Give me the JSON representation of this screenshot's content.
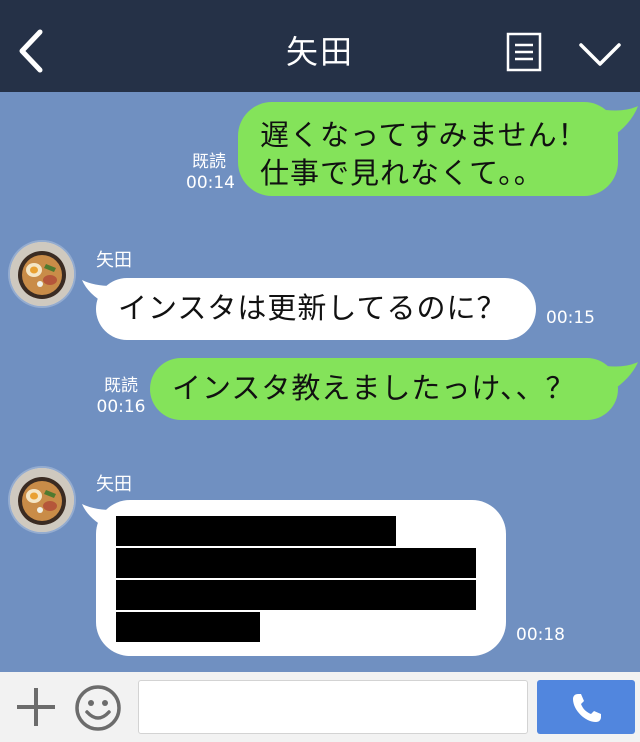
{
  "header": {
    "title": "矢田",
    "back_icon": "chevron-left-icon",
    "menu_icon": "menu-icon",
    "collapse_icon": "chevron-down-icon",
    "bg_color": "#253147"
  },
  "chat": {
    "bg_color": "#7090c1",
    "messages": [
      {
        "from": "me",
        "lines": [
          "遅くなってすみません！",
          "仕事で見れなくて。。"
        ],
        "read": "既読",
        "time": "00:14"
      },
      {
        "from": "them",
        "sender": "矢田",
        "text": "インスタは更新してるのに？",
        "time": "00:15"
      },
      {
        "from": "me",
        "text": "インスタ教えましたっけ、、？",
        "read": "既読",
        "time": "00:16"
      },
      {
        "from": "them",
        "sender": "矢田",
        "text_redacted": true,
        "time": "00:18"
      }
    ],
    "my_bubble_color": "#84e35a",
    "their_bubble_color": "#ffffff"
  },
  "input_bar": {
    "plus_icon": "plus-icon",
    "emoji_icon": "smiley-icon",
    "text_value": "",
    "placeholder": "",
    "call_icon": "phone-icon",
    "call_color": "#5186de"
  }
}
